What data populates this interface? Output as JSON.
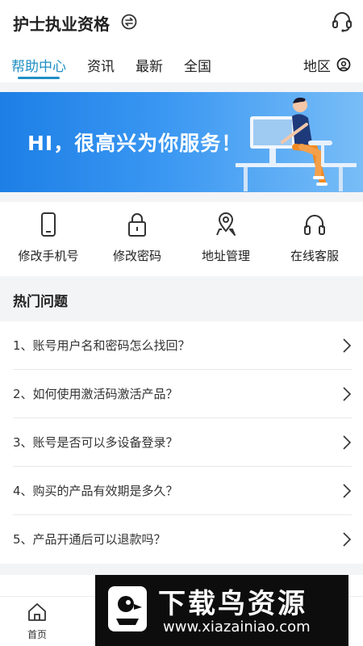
{
  "header": {
    "title": "护士执业资格",
    "switch_icon": "switch-icon",
    "support_icon": "customer-service-headset-icon"
  },
  "tabs": [
    {
      "label": "帮助中心",
      "active": true
    },
    {
      "label": "资讯",
      "active": false
    },
    {
      "label": "最新",
      "active": false
    },
    {
      "label": "全国",
      "active": false
    }
  ],
  "region": {
    "label": "地区",
    "icon": "location-pin-icon"
  },
  "banner": {
    "text": "HI，很高兴为你服务！"
  },
  "quick_actions": [
    {
      "label": "修改手机号",
      "icon": "phone-icon"
    },
    {
      "label": "修改密码",
      "icon": "lock-icon"
    },
    {
      "label": "地址管理",
      "icon": "location-icon"
    },
    {
      "label": "在线客服",
      "icon": "headphones-icon"
    }
  ],
  "hot": {
    "title": "热门问题",
    "questions": [
      "1、账号用户名和密码怎么找回？",
      "2、如何使用激活码激活产品？",
      "3、账号是否可以多设备登录？",
      "4、购买的产品有效期是多久？",
      "5、产品开通后可以退款吗？"
    ]
  },
  "bottom_nav": {
    "home_label": "首页",
    "home_icon": "home-icon"
  },
  "watermark": {
    "main": "下载鸟资源",
    "url": "www.xiazainiao.com"
  },
  "colors": {
    "accent": "#1f8ec4",
    "banner_start": "#1d7fe6",
    "banner_end": "#78bdf7",
    "band": "#f3f4f6"
  }
}
